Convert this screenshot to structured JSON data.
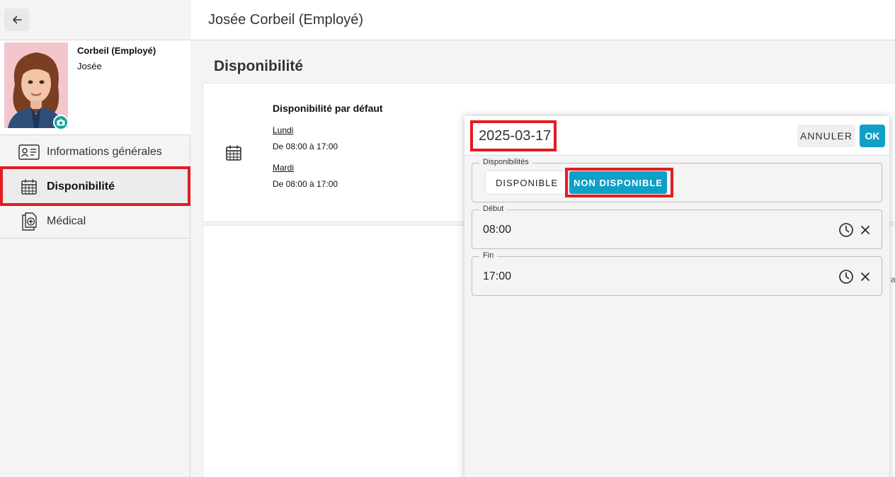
{
  "header": {
    "title": "Josée Corbeil (Employé)"
  },
  "profile": {
    "name": "Corbeil (Employé)",
    "first_name": "Josée"
  },
  "sidebar": {
    "items": [
      {
        "label": "Informations générales",
        "icon": "id-card-icon"
      },
      {
        "label": "Disponibilité",
        "icon": "calendar-icon",
        "active": true
      },
      {
        "label": "Médical",
        "icon": "medical-file-icon"
      }
    ]
  },
  "main": {
    "section_title": "Disponibilité",
    "default_title": "Disponibilité par défaut",
    "days": [
      {
        "day": "Lundi",
        "hours": "De 08:00 à 17:00"
      },
      {
        "day": "Mardi",
        "hours": "De 08:00 à 17:00"
      }
    ],
    "clipped_text": "ai"
  },
  "dialog": {
    "date": "2025-03-17",
    "cancel_label": "ANNULER",
    "ok_label": "OK",
    "availability_legend": "Disponibilités",
    "available_label": "DISPONIBLE",
    "unavailable_label": "NON DISPONIBLE",
    "start_legend": "Début",
    "start_value": "08:00",
    "end_legend": "Fin",
    "end_value": "17:00"
  },
  "colors": {
    "accent": "#0fa0c8",
    "highlight": "#e31b23",
    "badge": "#11a59a"
  }
}
